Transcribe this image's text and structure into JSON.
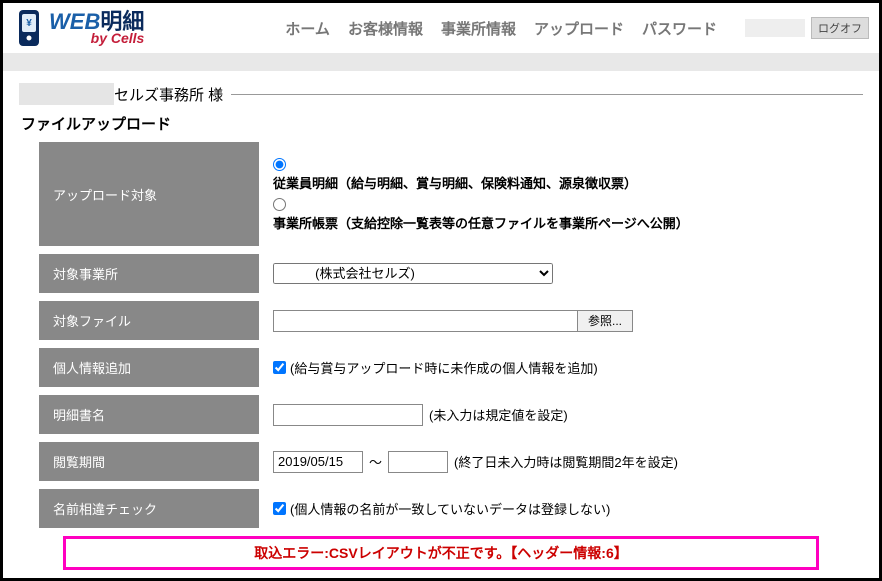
{
  "logo": {
    "web": "WEB",
    "meisai": "明細",
    "sub": "by Cells"
  },
  "nav": {
    "home": "ホーム",
    "customer": "お客様情報",
    "office": "事業所情報",
    "upload": "アップロード",
    "password": "パスワード",
    "logoff": "ログオフ"
  },
  "titlebar": {
    "text": "セルズ事務所 様"
  },
  "section": "ファイルアップロード",
  "rows": {
    "uploadTarget": {
      "label": "アップロード対象",
      "opt1": "従業員明細（給与明細、賞与明細、保険料通知、源泉徴収票）",
      "opt2": "事業所帳票（支給控除一覧表等の任意ファイルを事業所ページへ公開）"
    },
    "targetOffice": {
      "label": "対象事業所",
      "selected": "(株式会社セルズ)"
    },
    "targetFile": {
      "label": "対象ファイル",
      "browse": "参照..."
    },
    "addInfo": {
      "label": "個人情報追加",
      "text": "(給与賞与アップロード時に未作成の個人情報を追加)"
    },
    "docName": {
      "label": "明細書名",
      "hint": "(未入力は規定値を設定)"
    },
    "viewPeriod": {
      "label": "閲覧期間",
      "start": "2019/05/15",
      "hint": "(終了日未入力時は閲覧期間2年を設定)"
    },
    "nameCheck": {
      "label": "名前相違チェック",
      "text": "(個人情報の名前が一致していないデータは登録しない)"
    }
  },
  "error": "取込エラー:CSVレイアウトが不正です。【ヘッダー情報:6】"
}
